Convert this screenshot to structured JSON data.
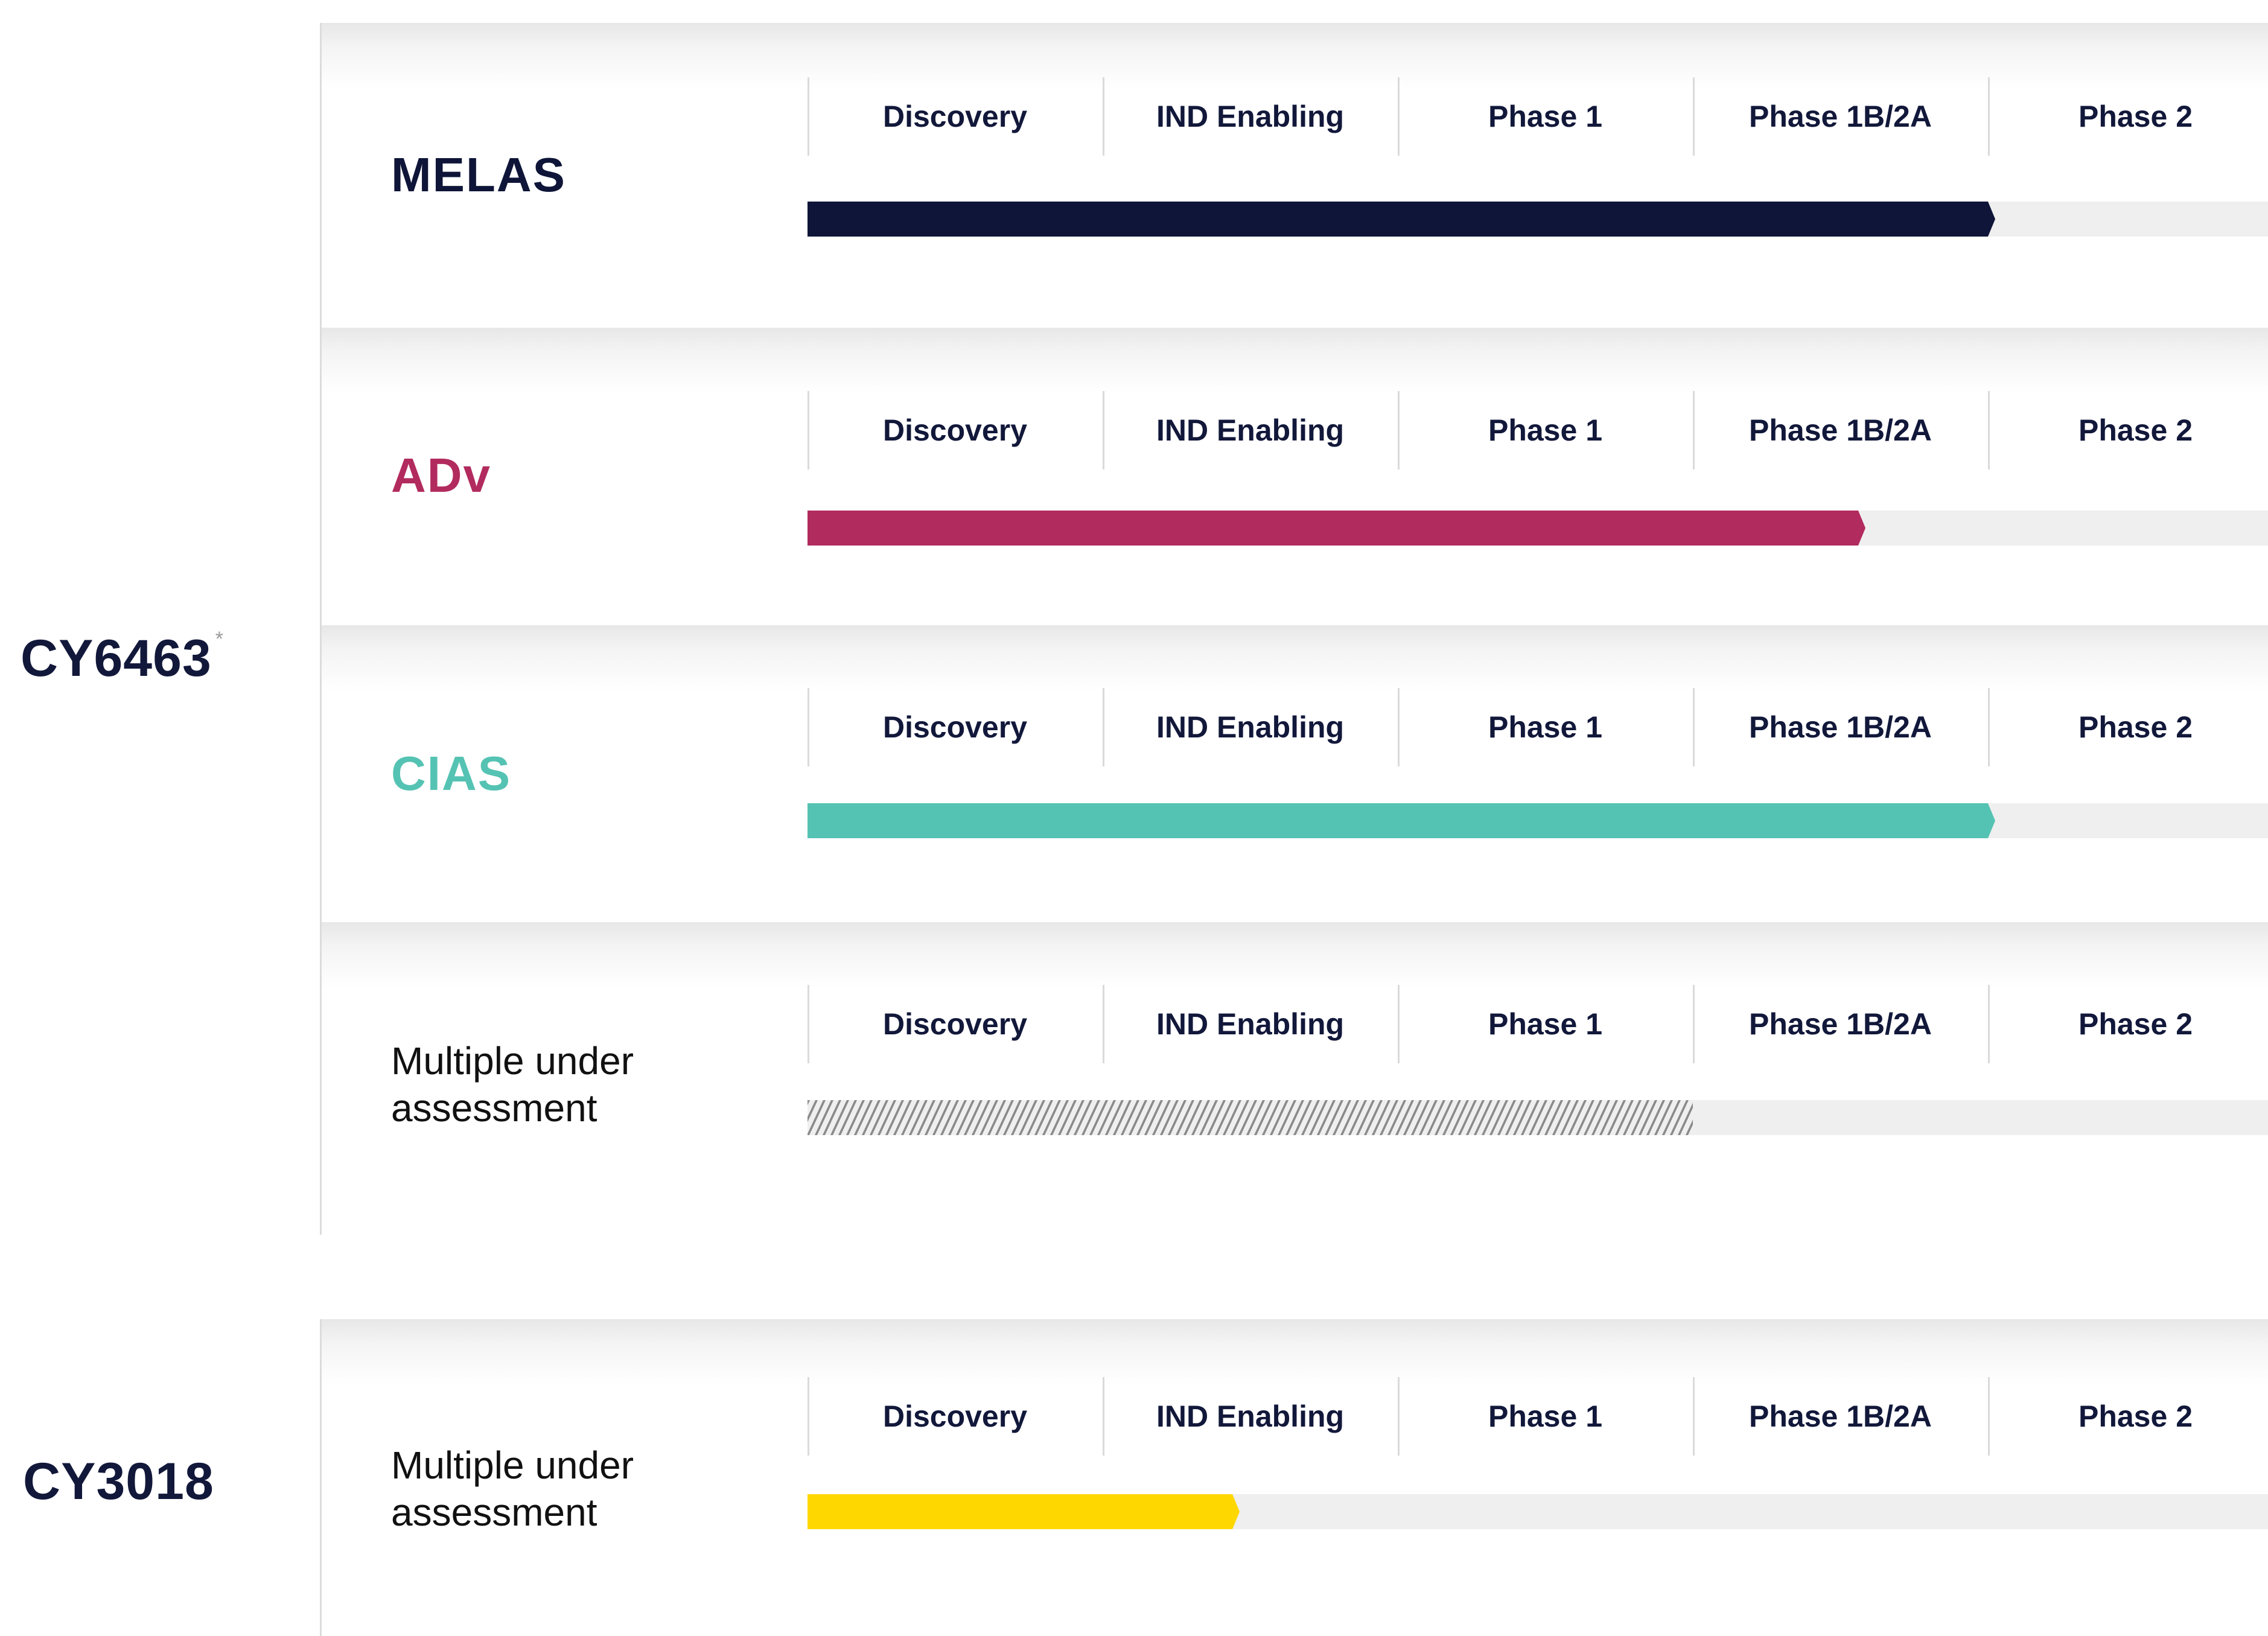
{
  "chart_data": {
    "type": "bar",
    "stages": [
      "Discovery",
      "IND Enabling",
      "Phase 1",
      "Phase 1B/2A",
      "Phase 2"
    ],
    "programs": [
      {
        "name": "CY6463",
        "footnote_mark": "*"
      },
      {
        "name": "CY3018",
        "footnote_mark": ""
      }
    ],
    "rows": [
      {
        "program": "CY6463",
        "indication": "MELAS",
        "style": "title",
        "color": "#0e1538",
        "progress_stages": 4.0,
        "pattern": "solid"
      },
      {
        "program": "CY6463",
        "indication": "ADv",
        "style": "title",
        "color": "#b22b5e",
        "progress_stages": 3.56,
        "pattern": "solid"
      },
      {
        "program": "CY6463",
        "indication": "CIAS",
        "style": "title",
        "color": "#55c3b3",
        "progress_stages": 4.0,
        "pattern": "solid"
      },
      {
        "program": "CY6463",
        "indication": "Multiple under assessment",
        "style": "multi",
        "color": "#8a8a8a",
        "progress_stages": 3.0,
        "pattern": "hatched"
      },
      {
        "program": "CY3018",
        "indication": "Multiple under assessment",
        "style": "multi",
        "color": "#ffd700",
        "progress_stages": 1.44,
        "pattern": "solid"
      }
    ],
    "track_color": "#efefef"
  }
}
